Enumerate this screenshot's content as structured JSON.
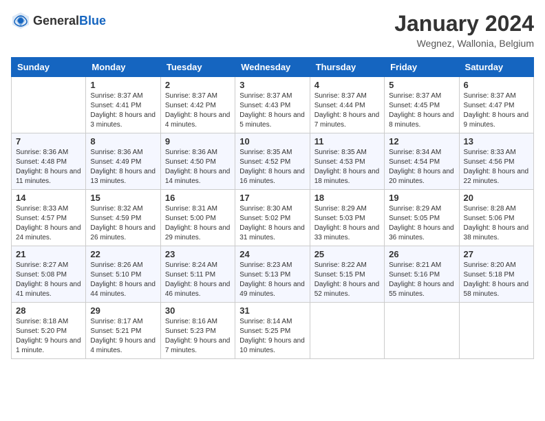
{
  "header": {
    "logo_general": "General",
    "logo_blue": "Blue",
    "month": "January 2024",
    "location": "Wegnez, Wallonia, Belgium"
  },
  "weekdays": [
    "Sunday",
    "Monday",
    "Tuesday",
    "Wednesday",
    "Thursday",
    "Friday",
    "Saturday"
  ],
  "weeks": [
    [
      {
        "day": "",
        "sunrise": "",
        "sunset": "",
        "daylight": ""
      },
      {
        "day": "1",
        "sunrise": "Sunrise: 8:37 AM",
        "sunset": "Sunset: 4:41 PM",
        "daylight": "Daylight: 8 hours and 3 minutes."
      },
      {
        "day": "2",
        "sunrise": "Sunrise: 8:37 AM",
        "sunset": "Sunset: 4:42 PM",
        "daylight": "Daylight: 8 hours and 4 minutes."
      },
      {
        "day": "3",
        "sunrise": "Sunrise: 8:37 AM",
        "sunset": "Sunset: 4:43 PM",
        "daylight": "Daylight: 8 hours and 5 minutes."
      },
      {
        "day": "4",
        "sunrise": "Sunrise: 8:37 AM",
        "sunset": "Sunset: 4:44 PM",
        "daylight": "Daylight: 8 hours and 7 minutes."
      },
      {
        "day": "5",
        "sunrise": "Sunrise: 8:37 AM",
        "sunset": "Sunset: 4:45 PM",
        "daylight": "Daylight: 8 hours and 8 minutes."
      },
      {
        "day": "6",
        "sunrise": "Sunrise: 8:37 AM",
        "sunset": "Sunset: 4:47 PM",
        "daylight": "Daylight: 8 hours and 9 minutes."
      }
    ],
    [
      {
        "day": "7",
        "sunrise": "Sunrise: 8:36 AM",
        "sunset": "Sunset: 4:48 PM",
        "daylight": "Daylight: 8 hours and 11 minutes."
      },
      {
        "day": "8",
        "sunrise": "Sunrise: 8:36 AM",
        "sunset": "Sunset: 4:49 PM",
        "daylight": "Daylight: 8 hours and 13 minutes."
      },
      {
        "day": "9",
        "sunrise": "Sunrise: 8:36 AM",
        "sunset": "Sunset: 4:50 PM",
        "daylight": "Daylight: 8 hours and 14 minutes."
      },
      {
        "day": "10",
        "sunrise": "Sunrise: 8:35 AM",
        "sunset": "Sunset: 4:52 PM",
        "daylight": "Daylight: 8 hours and 16 minutes."
      },
      {
        "day": "11",
        "sunrise": "Sunrise: 8:35 AM",
        "sunset": "Sunset: 4:53 PM",
        "daylight": "Daylight: 8 hours and 18 minutes."
      },
      {
        "day": "12",
        "sunrise": "Sunrise: 8:34 AM",
        "sunset": "Sunset: 4:54 PM",
        "daylight": "Daylight: 8 hours and 20 minutes."
      },
      {
        "day": "13",
        "sunrise": "Sunrise: 8:33 AM",
        "sunset": "Sunset: 4:56 PM",
        "daylight": "Daylight: 8 hours and 22 minutes."
      }
    ],
    [
      {
        "day": "14",
        "sunrise": "Sunrise: 8:33 AM",
        "sunset": "Sunset: 4:57 PM",
        "daylight": "Daylight: 8 hours and 24 minutes."
      },
      {
        "day": "15",
        "sunrise": "Sunrise: 8:32 AM",
        "sunset": "Sunset: 4:59 PM",
        "daylight": "Daylight: 8 hours and 26 minutes."
      },
      {
        "day": "16",
        "sunrise": "Sunrise: 8:31 AM",
        "sunset": "Sunset: 5:00 PM",
        "daylight": "Daylight: 8 hours and 29 minutes."
      },
      {
        "day": "17",
        "sunrise": "Sunrise: 8:30 AM",
        "sunset": "Sunset: 5:02 PM",
        "daylight": "Daylight: 8 hours and 31 minutes."
      },
      {
        "day": "18",
        "sunrise": "Sunrise: 8:29 AM",
        "sunset": "Sunset: 5:03 PM",
        "daylight": "Daylight: 8 hours and 33 minutes."
      },
      {
        "day": "19",
        "sunrise": "Sunrise: 8:29 AM",
        "sunset": "Sunset: 5:05 PM",
        "daylight": "Daylight: 8 hours and 36 minutes."
      },
      {
        "day": "20",
        "sunrise": "Sunrise: 8:28 AM",
        "sunset": "Sunset: 5:06 PM",
        "daylight": "Daylight: 8 hours and 38 minutes."
      }
    ],
    [
      {
        "day": "21",
        "sunrise": "Sunrise: 8:27 AM",
        "sunset": "Sunset: 5:08 PM",
        "daylight": "Daylight: 8 hours and 41 minutes."
      },
      {
        "day": "22",
        "sunrise": "Sunrise: 8:26 AM",
        "sunset": "Sunset: 5:10 PM",
        "daylight": "Daylight: 8 hours and 44 minutes."
      },
      {
        "day": "23",
        "sunrise": "Sunrise: 8:24 AM",
        "sunset": "Sunset: 5:11 PM",
        "daylight": "Daylight: 8 hours and 46 minutes."
      },
      {
        "day": "24",
        "sunrise": "Sunrise: 8:23 AM",
        "sunset": "Sunset: 5:13 PM",
        "daylight": "Daylight: 8 hours and 49 minutes."
      },
      {
        "day": "25",
        "sunrise": "Sunrise: 8:22 AM",
        "sunset": "Sunset: 5:15 PM",
        "daylight": "Daylight: 8 hours and 52 minutes."
      },
      {
        "day": "26",
        "sunrise": "Sunrise: 8:21 AM",
        "sunset": "Sunset: 5:16 PM",
        "daylight": "Daylight: 8 hours and 55 minutes."
      },
      {
        "day": "27",
        "sunrise": "Sunrise: 8:20 AM",
        "sunset": "Sunset: 5:18 PM",
        "daylight": "Daylight: 8 hours and 58 minutes."
      }
    ],
    [
      {
        "day": "28",
        "sunrise": "Sunrise: 8:18 AM",
        "sunset": "Sunset: 5:20 PM",
        "daylight": "Daylight: 9 hours and 1 minute."
      },
      {
        "day": "29",
        "sunrise": "Sunrise: 8:17 AM",
        "sunset": "Sunset: 5:21 PM",
        "daylight": "Daylight: 9 hours and 4 minutes."
      },
      {
        "day": "30",
        "sunrise": "Sunrise: 8:16 AM",
        "sunset": "Sunset: 5:23 PM",
        "daylight": "Daylight: 9 hours and 7 minutes."
      },
      {
        "day": "31",
        "sunrise": "Sunrise: 8:14 AM",
        "sunset": "Sunset: 5:25 PM",
        "daylight": "Daylight: 9 hours and 10 minutes."
      },
      {
        "day": "",
        "sunrise": "",
        "sunset": "",
        "daylight": ""
      },
      {
        "day": "",
        "sunrise": "",
        "sunset": "",
        "daylight": ""
      },
      {
        "day": "",
        "sunrise": "",
        "sunset": "",
        "daylight": ""
      }
    ]
  ]
}
